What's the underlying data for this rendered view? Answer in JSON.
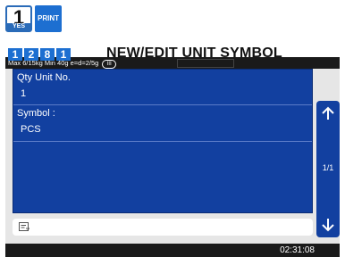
{
  "top_keys": {
    "yes_key": {
      "number": "1",
      "label": "YES"
    },
    "print_key": {
      "label": "PRINT"
    }
  },
  "status_bar": {
    "capacity": "Max 6/15kg Min 40g e=d=2/5g",
    "class_badge": "III"
  },
  "menu": {
    "code_digits": [
      "1",
      "2",
      "8",
      "1"
    ],
    "title": "NEW/EDIT UNIT SYMBOL"
  },
  "form": {
    "qty_unit_no": {
      "label": "Qty Unit No.",
      "value": "1"
    },
    "symbol": {
      "label": "Symbol :",
      "value": "PCS"
    }
  },
  "input": {
    "value": "",
    "icon": "memo-icon"
  },
  "pager": {
    "text": "1/1",
    "up_icon": "arrow-up-icon",
    "down_icon": "arrow-down-icon"
  },
  "clock": {
    "time": "02:31:08"
  },
  "colors": {
    "accent": "#1d6fd1",
    "panel": "#1240a0",
    "bar": "#1a1a1a"
  }
}
